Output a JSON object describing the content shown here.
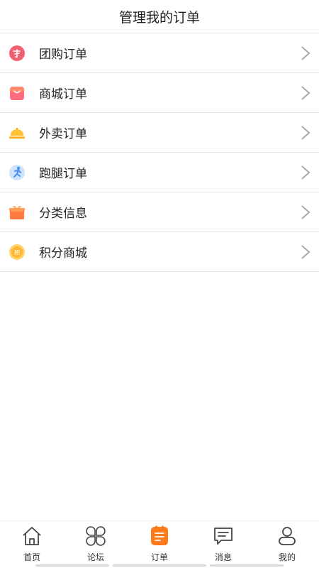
{
  "header": {
    "title": "管理我的订单"
  },
  "orders": [
    {
      "label": "团购订单",
      "icon": "group-buy-icon"
    },
    {
      "label": "商城订单",
      "icon": "shopping-bag-icon"
    },
    {
      "label": "外卖订单",
      "icon": "food-cloche-icon"
    },
    {
      "label": "跑腿订单",
      "icon": "runner-icon"
    },
    {
      "label": "分类信息",
      "icon": "gift-box-icon"
    },
    {
      "label": "积分商城",
      "icon": "points-coin-icon"
    }
  ],
  "tabbar": [
    {
      "label": "首页",
      "icon": "home-icon"
    },
    {
      "label": "论坛",
      "icon": "forum-icon"
    },
    {
      "label": "订单",
      "icon": "orders-icon",
      "active": true
    },
    {
      "label": "消息",
      "icon": "message-icon"
    },
    {
      "label": "我的",
      "icon": "profile-icon"
    }
  ],
  "colors": {
    "accent": "#ff7a1a",
    "divider": "#e6e6e6"
  }
}
